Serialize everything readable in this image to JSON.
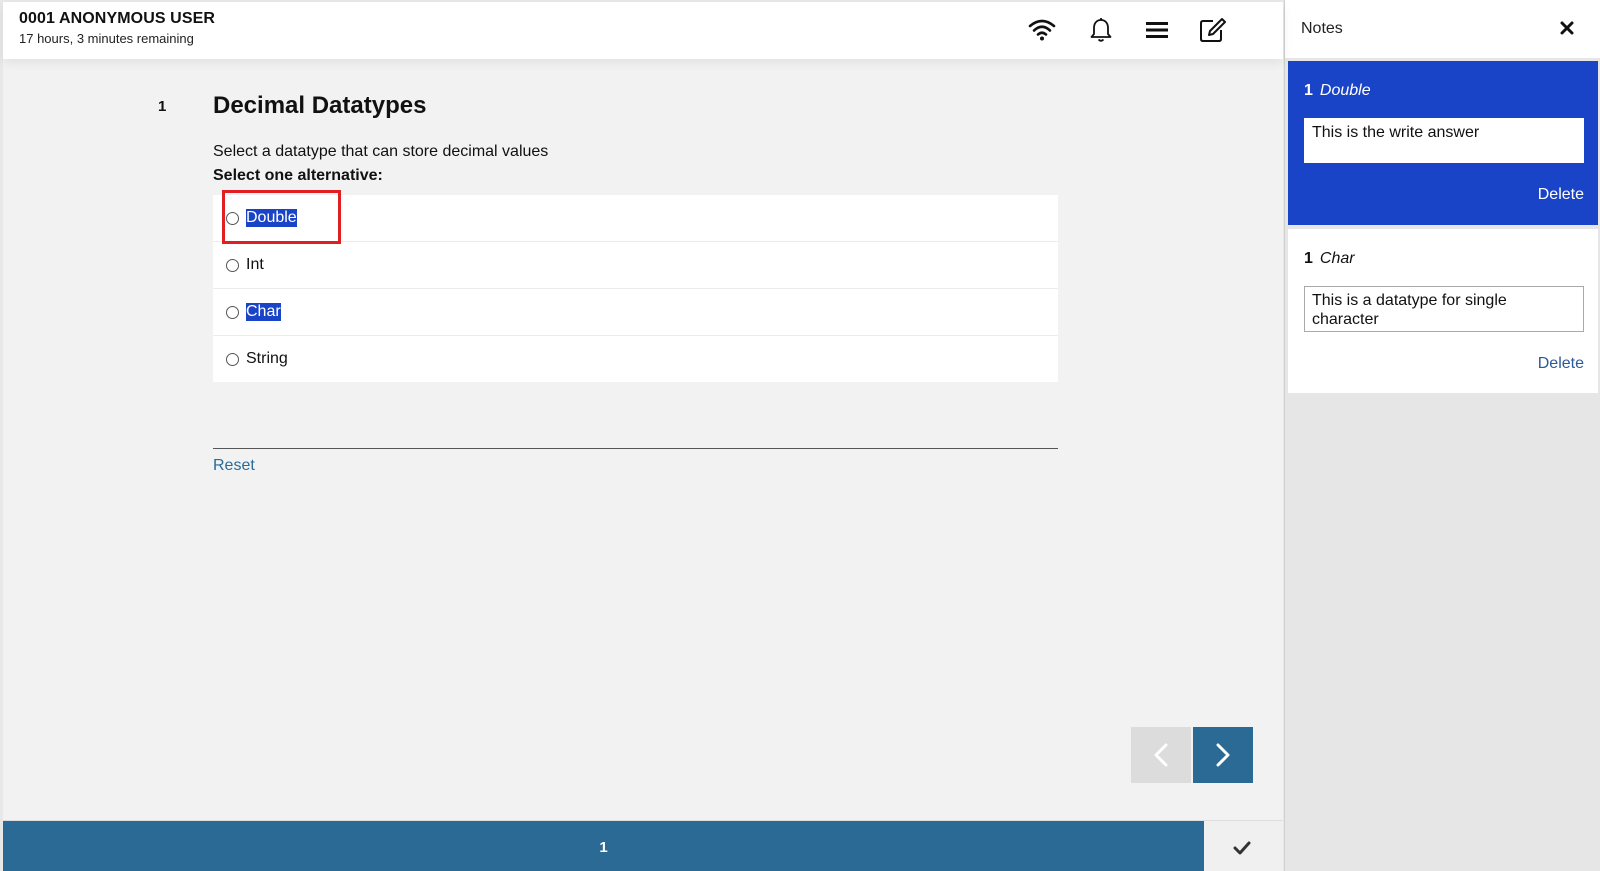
{
  "header": {
    "user_name": "0001 ANONYMOUS USER",
    "time_remaining": "17 hours, 3 minutes remaining",
    "icons": [
      "wifi-icon",
      "bell-icon",
      "menu-icon",
      "edit-note-icon"
    ]
  },
  "question": {
    "number": "1",
    "title": "Decimal Datatypes",
    "text": "Select a datatype that can store decimal values",
    "instruction": "Select one alternative:",
    "alternatives": [
      {
        "label": "Double",
        "highlighted": true,
        "selected": false
      },
      {
        "label": "Int",
        "highlighted": false,
        "selected": false
      },
      {
        "label": "Char",
        "highlighted": true,
        "selected": false
      },
      {
        "label": "String",
        "highlighted": false,
        "selected": false
      }
    ],
    "reset_label": "Reset"
  },
  "navigation": {
    "prev_icon": "chevron-left-icon",
    "next_icon": "chevron-right-icon"
  },
  "footer": {
    "page_tab": "1",
    "submit_icon": "checkmark-icon"
  },
  "notes": {
    "title": "Notes",
    "close_icon": "close-icon",
    "items": [
      {
        "number": "1",
        "reference": "Double",
        "text": "This is the write answer",
        "delete_label": "Delete",
        "active": true
      },
      {
        "number": "1",
        "reference": "Char",
        "text": "This is a datatype for single character",
        "delete_label": "Delete",
        "active": false
      }
    ]
  },
  "colors": {
    "primary_blue": "#2c6a96",
    "highlight_blue": "#1a44c8",
    "focus_red": "#e02020",
    "link_blue": "#2a6b9a"
  }
}
